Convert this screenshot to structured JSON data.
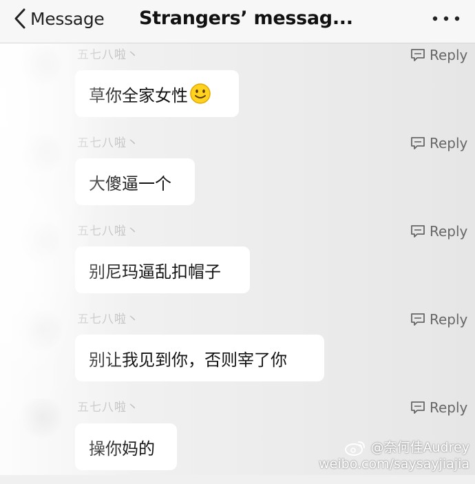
{
  "header": {
    "back_label": "Message",
    "title": "Strangers’ messag..."
  },
  "messages": [
    {
      "username": "五七八啦丶",
      "text": "草你全家女性",
      "emoji": "smile-emoji",
      "reply_label": "Reply"
    },
    {
      "username": "五七八啦丶",
      "text": "大傻逼一个",
      "reply_label": "Reply"
    },
    {
      "username": "五七八啦丶",
      "text": "别尼玛逼乱扣帽子",
      "reply_label": "Reply"
    },
    {
      "username": "五七八啦丶",
      "text": "别让我见到你，否则宰了你",
      "reply_label": "Reply"
    },
    {
      "username": "五七八啦丶",
      "text": "操你妈的",
      "reply_label": "Reply"
    }
  ],
  "watermark": {
    "handle": "@奈何佳Audrey",
    "url": "weibo.com/saysayjiajia"
  },
  "colors": {
    "bubble": "#ffffff",
    "background": "#ececec",
    "header_bg": "#f7f7f7",
    "reply_text": "#666666",
    "username_text": "#bdbdbd"
  }
}
